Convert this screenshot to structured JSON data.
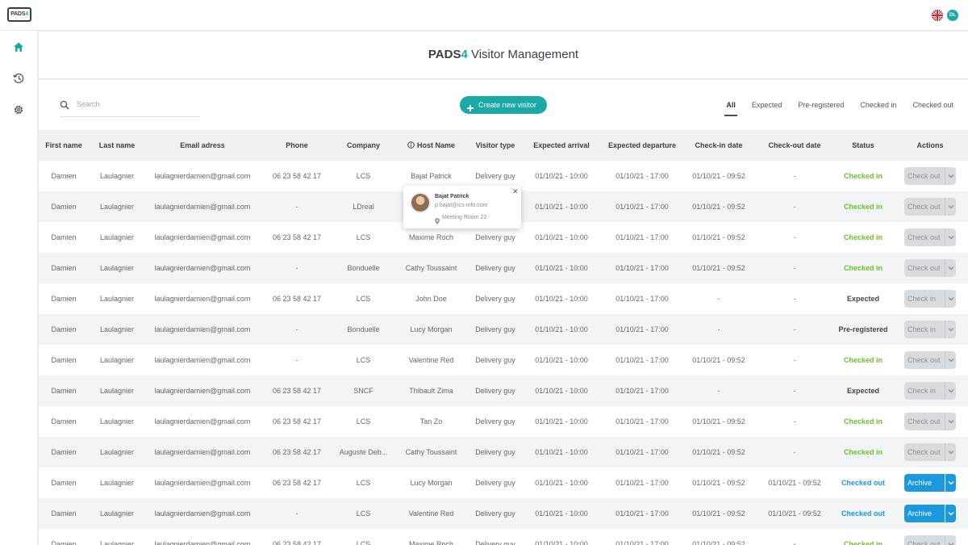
{
  "app": {
    "logo_text": "PADS",
    "logo_digit": "4",
    "user_initials": "DL"
  },
  "header": {
    "brand": "PADS",
    "brand_digit": "4",
    "title_rest": " Visitor Management"
  },
  "toolbar": {
    "search_placeholder": "Search",
    "create_label": "Create new visitor",
    "filters": [
      "All",
      "Expected",
      "Pre-registered",
      "Checked in",
      "Checked out"
    ],
    "active_filter": "All"
  },
  "table": {
    "columns": [
      "First name",
      "Last name",
      "Email adress",
      "Phone",
      "Company",
      "Host Name",
      "Visitor type",
      "Expected arrival",
      "Expected departure",
      "Check-in date",
      "Check-out date",
      "Status",
      "Actions"
    ],
    "rows": [
      {
        "first": "Damien",
        "last": "Laulagnier",
        "email": "laulagnierdamien@gmail.com",
        "phone": "06 23 58 42 17",
        "company": "LCS",
        "host": "Bajat Patrick",
        "type": "Delivery guy",
        "arrival": "01/10/21 - 10:00",
        "departure": "01/10/21 - 17:00",
        "checkin": "01/10/21 - 09:52",
        "checkout": "-",
        "status": "Checked in",
        "status_kind": "in",
        "action": "Check out"
      },
      {
        "first": "Damien",
        "last": "Laulagnier",
        "email": "laulagnierdamien@gmail.com",
        "phone": "-",
        "company": "LDreal",
        "host": "",
        "type": "",
        "arrival": "01/10/21 - 10:00",
        "departure": "01/10/21 - 17:00",
        "checkin": "01/10/21 - 09:52",
        "checkout": "-",
        "status": "Checked in",
        "status_kind": "in",
        "action": "Check out"
      },
      {
        "first": "Damien",
        "last": "Laulagnier",
        "email": "laulagnierdamien@gmail.com",
        "phone": "06 23 58 42 17",
        "company": "LCS",
        "host": "Maxime Roch",
        "type": "Delivery guy",
        "arrival": "01/10/21 - 10:00",
        "departure": "01/10/21 - 17:00",
        "checkin": "01/10/21 - 09:52",
        "checkout": "-",
        "status": "Checked in",
        "status_kind": "in",
        "action": "Check out"
      },
      {
        "first": "Damien",
        "last": "Laulagnier",
        "email": "laulagnierdamien@gmail.com",
        "phone": "-",
        "company": "Bonduelle",
        "host": "Cathy Toussaint",
        "type": "Delivery guy",
        "arrival": "01/10/21 - 10:00",
        "departure": "01/10/21 - 17:00",
        "checkin": "01/10/21 - 09:52",
        "checkout": "-",
        "status": "Checked in",
        "status_kind": "in",
        "action": "Check out"
      },
      {
        "first": "Damien",
        "last": "Laulagnier",
        "email": "laulagnierdamien@gmail.com",
        "phone": "06 23 58 42 17",
        "company": "LCS",
        "host": "John Doe",
        "type": "Delivery guy",
        "arrival": "01/10/21 - 10:00",
        "departure": "01/10/21 - 17:00",
        "checkin": "-",
        "checkout": "-",
        "status": "Expected",
        "status_kind": "exp",
        "action": "Check in"
      },
      {
        "first": "Damien",
        "last": "Laulagnier",
        "email": "laulagnierdamien@gmail.com",
        "phone": "-",
        "company": "Bonduelle",
        "host": "Lucy Morgan",
        "type": "Delivery guy",
        "arrival": "01/10/21 - 10:00",
        "departure": "01/10/21 - 17:00",
        "checkin": "-",
        "checkout": "-",
        "status": "Pre-registered",
        "status_kind": "exp",
        "action": "Check in"
      },
      {
        "first": "Damien",
        "last": "Laulagnier",
        "email": "laulagnierdamien@gmail.com",
        "phone": "-",
        "company": "LCS",
        "host": "Valentine Red",
        "type": "Delivery guy",
        "arrival": "01/10/21 - 10:00",
        "departure": "01/10/21 - 17:00",
        "checkin": "01/10/21 - 09:52",
        "checkout": "-",
        "status": "Checked in",
        "status_kind": "in",
        "action": "Check out"
      },
      {
        "first": "Damien",
        "last": "Laulagnier",
        "email": "laulagnierdamien@gmail.com",
        "phone": "06 23 58 42 17",
        "company": "SNCF",
        "host": "Thibault Zima",
        "type": "Delivery guy",
        "arrival": "01/10/21 - 10:00",
        "departure": "01/10/21 - 17:00",
        "checkin": "-",
        "checkout": "-",
        "status": "Expected",
        "status_kind": "exp",
        "action": "Check in"
      },
      {
        "first": "Damien",
        "last": "Laulagnier",
        "email": "laulagnierdamien@gmail.com",
        "phone": "06 23 58 42 17",
        "company": "LCS",
        "host": "Tan Zo",
        "type": "Delivery guy",
        "arrival": "01/10/21 - 10:00",
        "departure": "01/10/21 - 17:00",
        "checkin": "01/10/21 - 09:52",
        "checkout": "-",
        "status": "Checked in",
        "status_kind": "in",
        "action": "Check out"
      },
      {
        "first": "Damien",
        "last": "Laulagnier",
        "email": "laulagnierdamien@gmail.com",
        "phone": "06 23 58 42 17",
        "company": "Auguste Deb...",
        "host": "Cathy Toussaint",
        "type": "Delivery guy",
        "arrival": "01/10/21 - 10:00",
        "departure": "01/10/21 - 17:00",
        "checkin": "01/10/21 - 09:52",
        "checkout": "-",
        "status": "Checked in",
        "status_kind": "in",
        "action": "Check out"
      },
      {
        "first": "Damien",
        "last": "Laulagnier",
        "email": "laulagnierdamien@gmail.com",
        "phone": "06 23 58 42 17",
        "company": "LCS",
        "host": "Lucy Morgan",
        "type": "Delivery guy",
        "arrival": "01/10/21 - 10:00",
        "departure": "01/10/21 - 17:00",
        "checkin": "01/10/21 - 09:52",
        "checkout": "01/10/21 - 09:52",
        "status": "Checked out",
        "status_kind": "out",
        "action": "Archive"
      },
      {
        "first": "Damien",
        "last": "Laulagnier",
        "email": "laulagnierdamien@gmail.com",
        "phone": "-",
        "company": "LCS",
        "host": "Valentine Red",
        "type": "Delivery guy",
        "arrival": "01/10/21 - 10:00",
        "departure": "01/10/21 - 17:00",
        "checkin": "01/10/21 - 09:52",
        "checkout": "01/10/21 - 09:52",
        "status": "Checked out",
        "status_kind": "out",
        "action": "Archive"
      },
      {
        "first": "Damien",
        "last": "Laulagnier",
        "email": "laulagnierdamien@gmail.com",
        "phone": "06 23 58 42 17",
        "company": "LCS",
        "host": "Maxime Roch",
        "type": "Delivery guy",
        "arrival": "01/10/21 - 10:00",
        "departure": "01/10/21 - 17:00",
        "checkin": "01/10/21 - 09:52",
        "checkout": "-",
        "status": "Checked in",
        "status_kind": "in",
        "action": "Check out"
      }
    ]
  },
  "popover": {
    "name": "Bajat Patrick",
    "email": "p.bajat@ics-info.com",
    "location": "Meeting Room 23"
  },
  "colors": {
    "accent": "#1aa9a6",
    "checked_in": "#6bbf2b",
    "checked_out": "#1a98e0"
  },
  "icons": {
    "sidebar": [
      "home-icon",
      "history-icon",
      "gear-icon"
    ],
    "toolbar": [
      "search-icon",
      "plus-icon"
    ],
    "header": [
      "info-icon"
    ]
  }
}
